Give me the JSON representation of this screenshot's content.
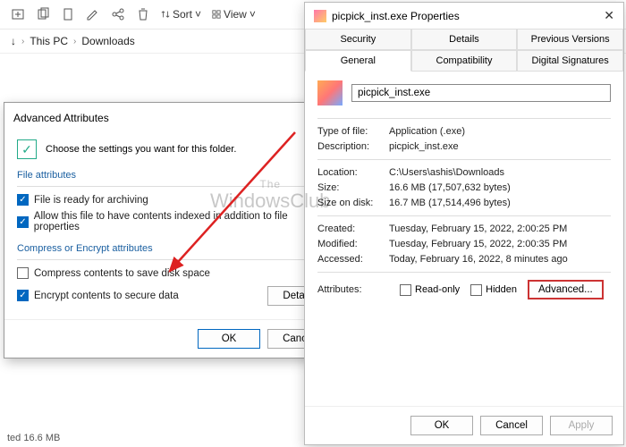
{
  "explorer": {
    "toolbar": {
      "view": "View",
      "sort": "Sort"
    },
    "breadcrumb": {
      "a": "This PC",
      "b": "Downloads"
    },
    "status": "ted   16.6 MB"
  },
  "advanced": {
    "title": "Advanced Attributes",
    "intro": "Choose the settings you want for this folder.",
    "group1": "File attributes",
    "cb1": "File is ready for archiving",
    "cb2": "Allow this file to have contents indexed in addition to file properties",
    "group2": "Compress or Encrypt attributes",
    "cb3": "Compress contents to save disk space",
    "cb4": "Encrypt contents to secure data",
    "details": "Details",
    "ok": "OK",
    "cancel": "Cancel"
  },
  "properties": {
    "title": "picpick_inst.exe Properties",
    "tabs": {
      "security": "Security",
      "details": "Details",
      "prev": "Previous Versions",
      "general": "General",
      "compat": "Compatibility",
      "sig": "Digital Signatures"
    },
    "filename": "picpick_inst.exe",
    "rows": {
      "type_l": "Type of file:",
      "type_v": "Application (.exe)",
      "desc_l": "Description:",
      "desc_v": "picpick_inst.exe",
      "loc_l": "Location:",
      "loc_v": "C:\\Users\\ashis\\Downloads",
      "size_l": "Size:",
      "size_v": "16.6 MB (17,507,632 bytes)",
      "disk_l": "Size on disk:",
      "disk_v": "16.7 MB (17,514,496 bytes)",
      "created_l": "Created:",
      "created_v": "Tuesday, February 15, 2022, 2:00:25 PM",
      "mod_l": "Modified:",
      "mod_v": "Tuesday, February 15, 2022, 2:00:35 PM",
      "acc_l": "Accessed:",
      "acc_v": "Today, February 16, 2022, 8 minutes ago",
      "attr_l": "Attributes:",
      "ro": "Read-only",
      "hidden": "Hidden",
      "advanced": "Advanced..."
    },
    "ok": "OK",
    "cancel": "Cancel",
    "apply": "Apply"
  },
  "watermark": {
    "top": "The",
    "main": "WindowsClub"
  }
}
